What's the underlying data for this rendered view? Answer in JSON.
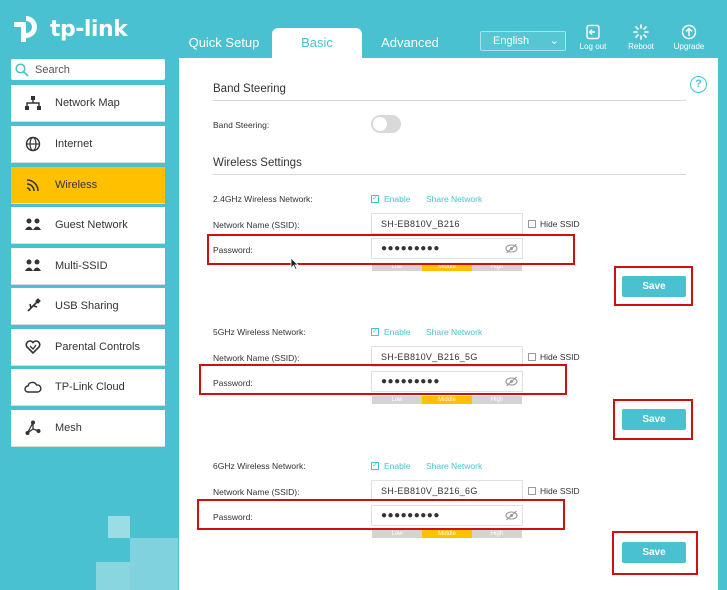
{
  "brand": {
    "name": "tp-link"
  },
  "nav": {
    "tabs": [
      "Quick Setup",
      "Basic",
      "Advanced"
    ],
    "active": "Basic"
  },
  "language": {
    "selected": "English"
  },
  "header_buttons": {
    "logout": "Log out",
    "reboot": "Reboot",
    "upgrade": "Upgrade"
  },
  "search": {
    "placeholder": "Search"
  },
  "sidebar": {
    "items": [
      {
        "label": "Network Map",
        "icon": "network-map-icon"
      },
      {
        "label": "Internet",
        "icon": "globe-icon"
      },
      {
        "label": "Wireless",
        "icon": "wifi-icon"
      },
      {
        "label": "Guest Network",
        "icon": "guest-icon"
      },
      {
        "label": "Multi-SSID",
        "icon": "multi-ssid-icon"
      },
      {
        "label": "USB Sharing",
        "icon": "usb-icon"
      },
      {
        "label": "Parental Controls",
        "icon": "heart-icon"
      },
      {
        "label": "TP-Link Cloud",
        "icon": "cloud-icon"
      },
      {
        "label": "Mesh",
        "icon": "mesh-icon"
      }
    ],
    "active": "Wireless"
  },
  "band_steering": {
    "title": "Band Steering",
    "label": "Band Steering:",
    "enabled": false
  },
  "wireless": {
    "title": "Wireless Settings",
    "networks": [
      {
        "band_label": "2.4GHz Wireless Network:",
        "enable_label": "Enable",
        "share_label": "Share Network",
        "ssid_label": "Network Name (SSID):",
        "ssid": "SH-EB810V_B216",
        "hide_ssid_label": "Hide SSID",
        "password_label": "Password:",
        "password": "●●●●●●●●●",
        "strength": [
          "Low",
          "Middle",
          "High"
        ],
        "save_label": "Save"
      },
      {
        "band_label": "5GHz Wireless Network:",
        "enable_label": "Enable",
        "share_label": "Share Network",
        "ssid_label": "Network Name (SSID):",
        "ssid": "SH-EB810V_B216_5G",
        "hide_ssid_label": "Hide SSID",
        "password_label": "Password:",
        "password": "●●●●●●●●●",
        "strength": [
          "Low",
          "Middle",
          "High"
        ],
        "save_label": "Save"
      },
      {
        "band_label": "6GHz Wireless Network:",
        "enable_label": "Enable",
        "share_label": "Share Network",
        "ssid_label": "Network Name (SSID):",
        "ssid": "SH-EB810V_B216_6G",
        "hide_ssid_label": "Hide SSID",
        "password_label": "Password:",
        "password": "●●●●●●●●●",
        "strength": [
          "Low",
          "Middle",
          "High"
        ],
        "save_label": "Save"
      }
    ]
  },
  "help": {
    "symbol": "?"
  },
  "colors": {
    "brand_teal": "#4ac1d0",
    "active_yellow": "#ffc000",
    "highlight_red": "#d01010"
  }
}
